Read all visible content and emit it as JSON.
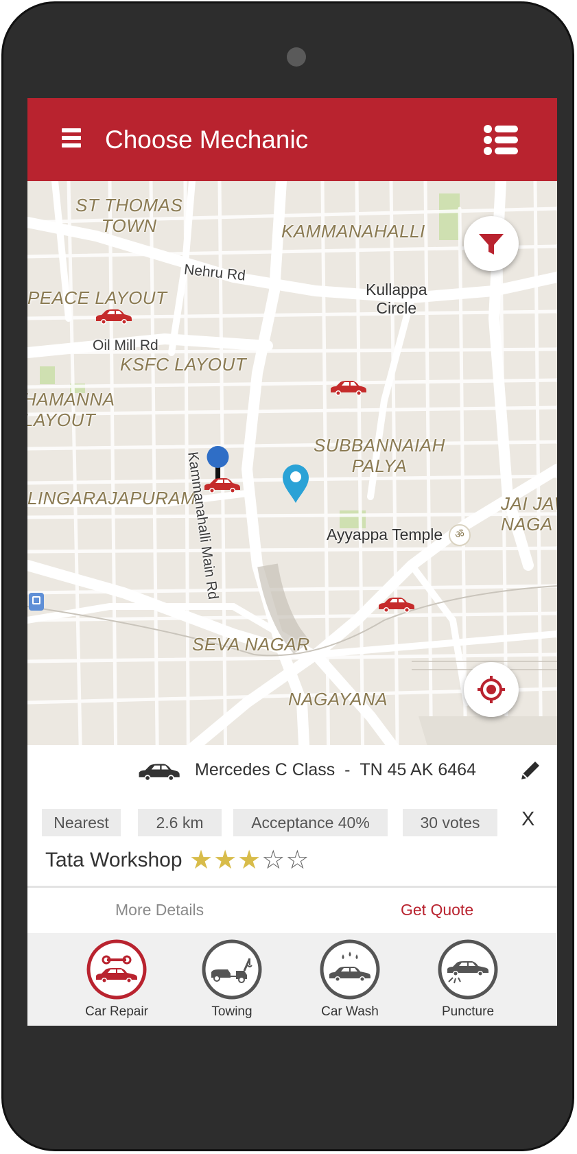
{
  "app": {
    "title": "Choose Mechanic",
    "accent_color": "#b9232f",
    "menu_icon": "hamburger-menu-icon",
    "list_icon": "list-view-icon"
  },
  "map": {
    "area_labels": [
      "ST THOMAS TOWN",
      "KAMMANAHALLI",
      "PEACE LAYOUT",
      "KSFC LAYOUT",
      "HAMANNA LAYOUT",
      "SUBBANNAIAH PALYA",
      "LINGARAJAPURAM",
      "JAI JAW NAGA",
      "SEVA NAGAR",
      "NAGAYANA"
    ],
    "road_labels": [
      "Nehru Rd",
      "Oil Mill Rd",
      "Kammanahalli Main Rd"
    ],
    "poi_labels": [
      "Kullappa Circle",
      "Ayyappa Temple"
    ],
    "filter_icon": "filter-funnel-icon",
    "locate_icon": "my-location-crosshair-icon"
  },
  "vehicle": {
    "icon": "car-icon",
    "name": "Mercedes C Class",
    "separator": "-",
    "plate": "TN 45 AK 6464",
    "edit_icon": "pencil-edit-icon"
  },
  "mechanic": {
    "chips": [
      "Nearest",
      "2.6 km",
      "Acceptance 40%",
      "30 votes"
    ],
    "close_label": "X",
    "name": "Tata Workshop",
    "rating": 3,
    "rating_max": 5
  },
  "actions": {
    "more_details": "More Details",
    "get_quote": "Get Quote"
  },
  "services": [
    {
      "label": "Car Repair",
      "icon": "car-repair-icon",
      "active": true
    },
    {
      "label": "Towing",
      "icon": "tow-truck-icon",
      "active": false
    },
    {
      "label": "Car Wash",
      "icon": "car-wash-icon",
      "active": false
    },
    {
      "label": "Puncture",
      "icon": "puncture-icon",
      "active": false
    }
  ]
}
